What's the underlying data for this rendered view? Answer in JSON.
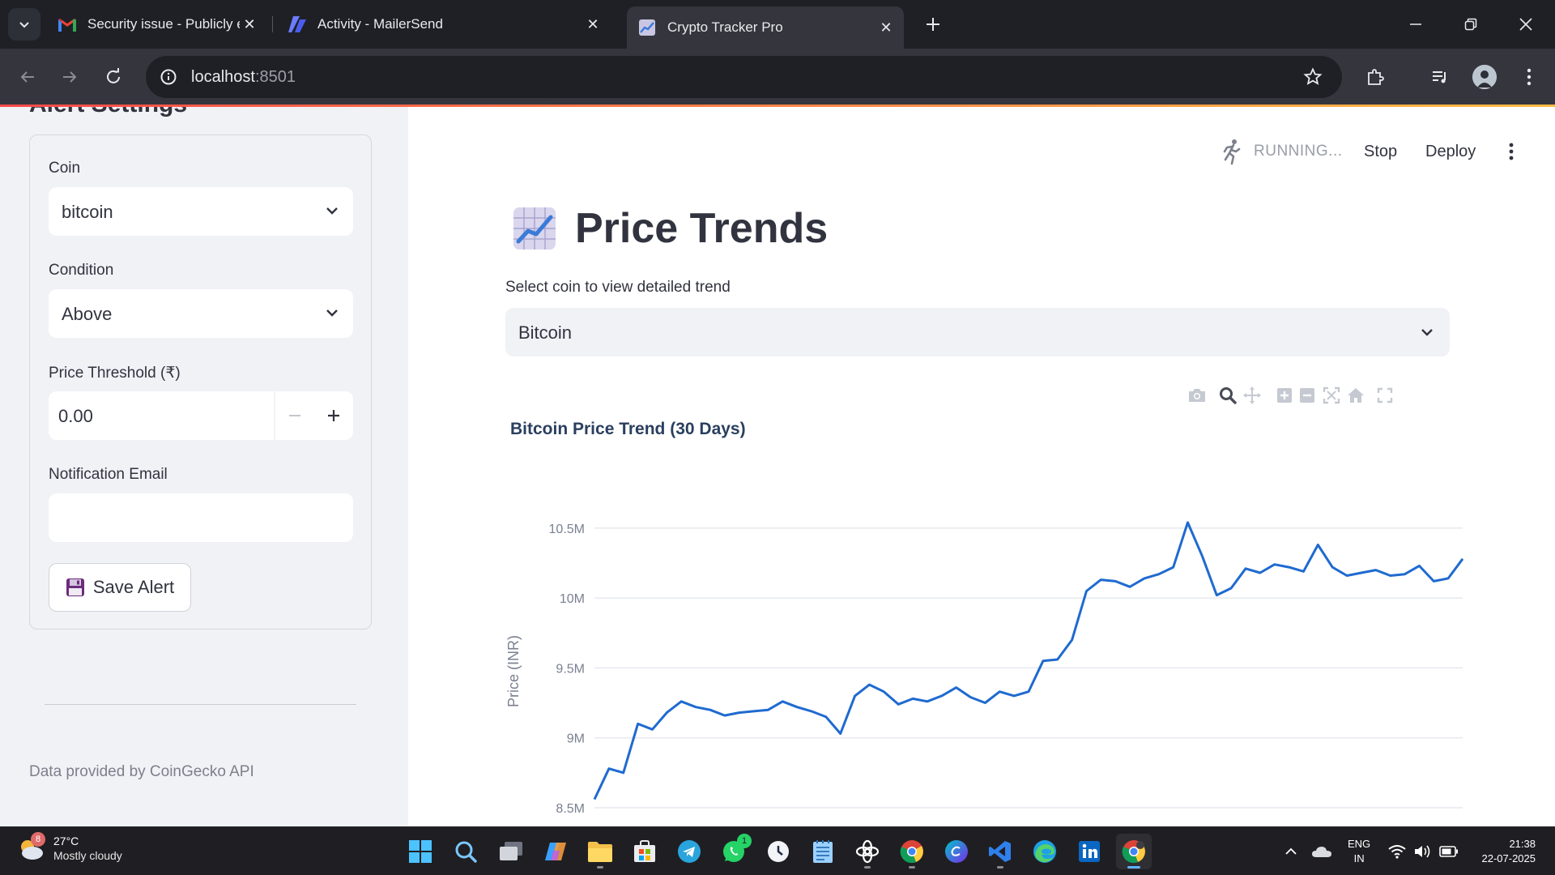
{
  "browser": {
    "tabs": [
      {
        "title": "Security issue - Publicly exposed s",
        "active": false,
        "favicon": "gmail-icon"
      },
      {
        "title": "Activity - MailerSend",
        "active": false,
        "favicon": "mailersend-icon"
      },
      {
        "title": "Crypto Tracker Pro",
        "active": true,
        "favicon": "chart-emoji-icon"
      }
    ],
    "url_host": "localhost",
    "url_port": ":8501"
  },
  "sidebar": {
    "heading": "Alert Settings",
    "coin_label": "Coin",
    "coin_value": "bitcoin",
    "condition_label": "Condition",
    "condition_value": "Above",
    "threshold_label": "Price Threshold (₹)",
    "threshold_value": "0.00",
    "email_label": "Notification Email",
    "email_value": "",
    "save_label": "Save Alert",
    "footer": "Data provided by CoinGecko API"
  },
  "header": {
    "status": "RUNNING...",
    "stop": "Stop",
    "deploy": "Deploy"
  },
  "main": {
    "title": "Price Trends",
    "select_label": "Select coin to view detailed trend",
    "select_value": "Bitcoin"
  },
  "chart_data": {
    "type": "line",
    "title": "Bitcoin Price Trend (30 Days)",
    "ylabel": "Price (INR)",
    "xlabel": "",
    "ylim": [
      8500000,
      10800000
    ],
    "yticks": [
      8500000,
      9000000,
      9500000,
      10000000,
      10500000
    ],
    "ytick_labels": [
      "8.5M",
      "9M",
      "9.5M",
      "10M",
      "10.5M"
    ],
    "grid": true,
    "color": "#1f6ad0",
    "x": [
      0,
      0.5,
      1,
      1.5,
      2,
      2.5,
      3,
      3.5,
      4,
      4.5,
      5,
      5.5,
      6,
      6.5,
      7,
      7.5,
      8,
      8.5,
      9,
      9.5,
      10,
      10.5,
      11,
      11.5,
      12,
      12.5,
      13,
      13.5,
      14,
      14.5,
      15,
      15.5,
      16,
      16.5,
      17,
      17.5,
      18,
      18.5,
      19,
      19.5,
      20,
      20.5,
      21,
      21.5,
      22,
      22.5,
      23,
      23.5,
      24,
      24.5,
      25,
      25.5,
      26,
      26.5,
      27,
      27.5,
      28,
      28.5,
      29,
      29.5,
      30
    ],
    "values": [
      8560000,
      8780000,
      8750000,
      9100000,
      9060000,
      9180000,
      9260000,
      9220000,
      9200000,
      9160000,
      9180000,
      9190000,
      9200000,
      9260000,
      9220000,
      9190000,
      9150000,
      9030000,
      9300000,
      9380000,
      9330000,
      9240000,
      9280000,
      9260000,
      9300000,
      9360000,
      9290000,
      9250000,
      9330000,
      9300000,
      9330000,
      9550000,
      9560000,
      9700000,
      10050000,
      10130000,
      10120000,
      10080000,
      10140000,
      10170000,
      10220000,
      10540000,
      10300000,
      10020000,
      10070000,
      10210000,
      10180000,
      10240000,
      10220000,
      10190000,
      10380000,
      10220000,
      10160000,
      10180000,
      10200000,
      10160000,
      10170000,
      10230000,
      10120000,
      10140000,
      10280000
    ]
  },
  "taskbar": {
    "weather_temp": "27°C",
    "weather_cond": "Mostly cloudy",
    "weather_badge": "8",
    "whatsapp_badge": "1",
    "lang_1": "ENG",
    "lang_2": "IN",
    "time": "21:38",
    "date": "22-07-2025"
  }
}
